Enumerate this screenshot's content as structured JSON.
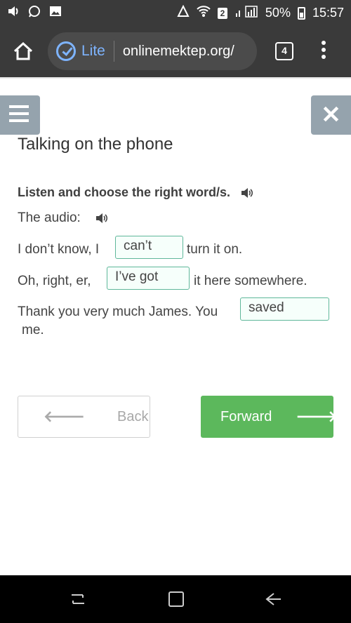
{
  "status_bar": {
    "icons_left": [
      "volume-icon",
      "whatsapp-icon",
      "image-icon"
    ],
    "sim_badge": "2",
    "battery": "50%",
    "time": "15:57"
  },
  "browser": {
    "lite_label": "Lite",
    "url": "onlinemektep.org/",
    "tab_count": "4"
  },
  "page": {
    "title": "Talking on the phone",
    "instruction": "Listen and choose the right word/s.",
    "audio_label": "The audio:",
    "sentences": [
      {
        "before": "I don’t know, I",
        "answer": "can’t",
        "after": "turn it on."
      },
      {
        "before": "Oh, right, er,",
        "answer": "I’ve got",
        "after": "it here somewhere."
      },
      {
        "before": "Thank you very much James. You",
        "answer": "saved",
        "after": "me."
      }
    ],
    "back_label": "Back",
    "forward_label": "Forward"
  },
  "colors": {
    "accent_green": "#5cb85c",
    "box_border": "#5fb79a",
    "side_button": "#95a3ad",
    "chrome": "#3a3a3a"
  }
}
